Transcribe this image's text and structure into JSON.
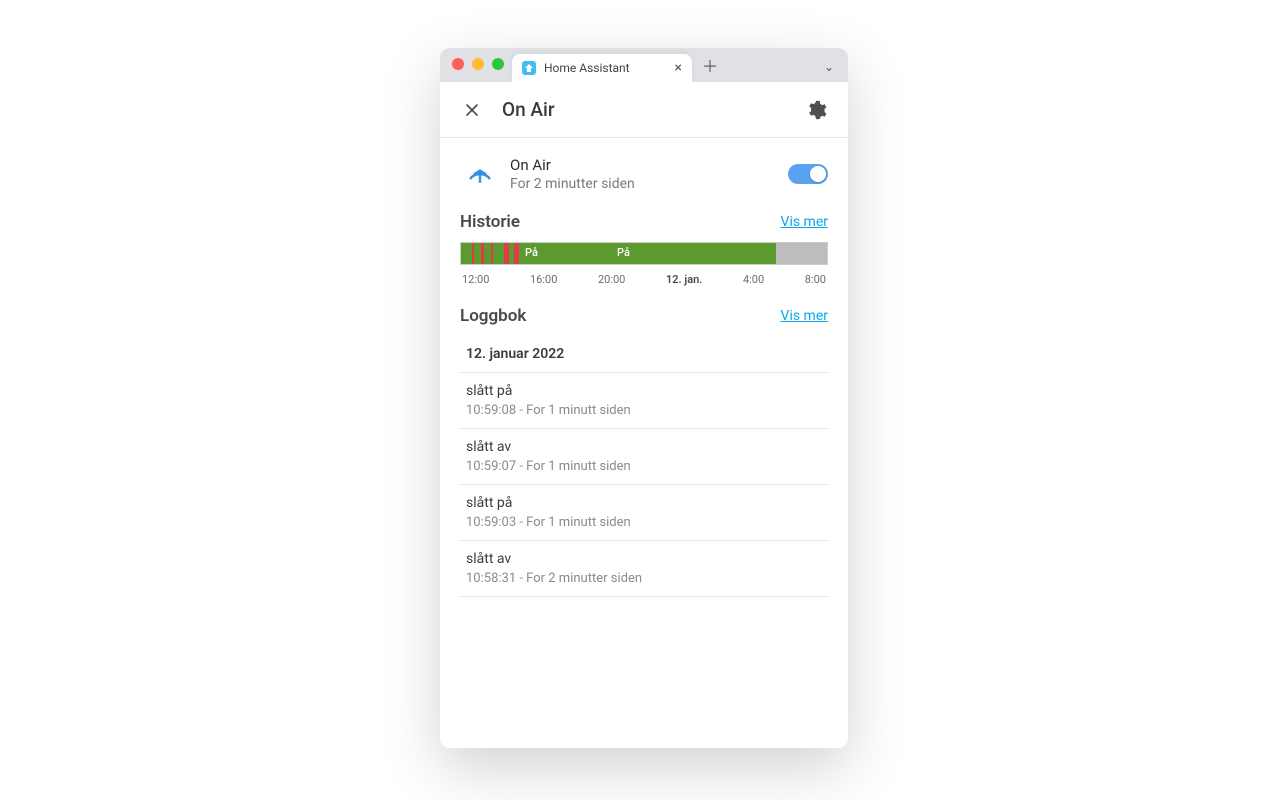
{
  "browser": {
    "tab_title": "Home Assistant"
  },
  "header": {
    "title": "On Air"
  },
  "entity": {
    "name": "On Air",
    "sub": "For 2 minutter siden",
    "state_on": true
  },
  "history": {
    "title": "Historie",
    "more": "Vis mer",
    "labels": {
      "on1": "På",
      "on2": "På"
    },
    "ticks": [
      "12:00",
      "16:00",
      "20:00",
      "12. jan.",
      "4:00",
      "8:00"
    ]
  },
  "logbook": {
    "title": "Loggbok",
    "more": "Vis mer",
    "date": "12. januar 2022",
    "entries": [
      {
        "title": "slått på",
        "sub": "10:59:08 - For 1 minutt siden"
      },
      {
        "title": "slått av",
        "sub": "10:59:07 - For 1 minutt siden"
      },
      {
        "title": "slått på",
        "sub": "10:59:03 - For 1 minutt siden"
      },
      {
        "title": "slått av",
        "sub": "10:58:31 - For 2 minutter siden"
      }
    ]
  }
}
